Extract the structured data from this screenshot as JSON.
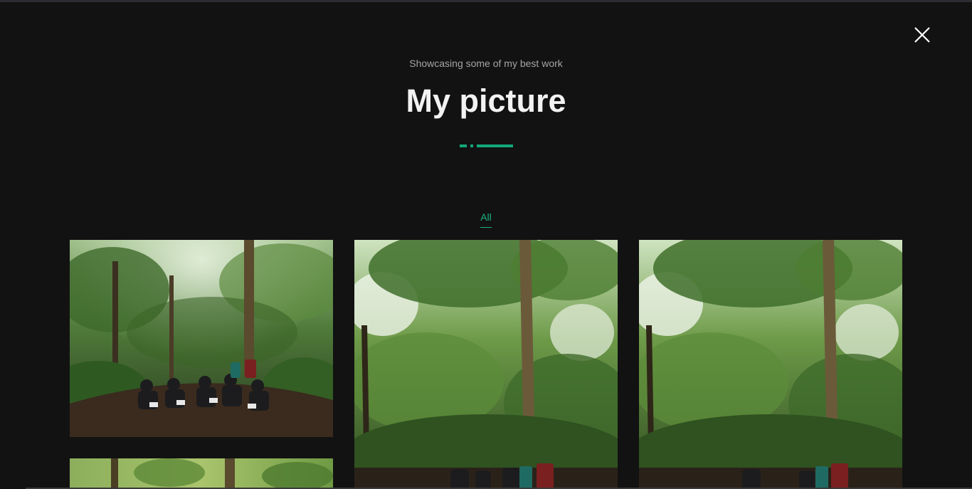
{
  "header": {
    "subtitle": "Showcasing some of my best work",
    "title": "My picture",
    "accent_color": "#12a87a"
  },
  "close_icon": "close-icon",
  "filters": [
    {
      "label": "All",
      "active": true
    }
  ],
  "gallery": [
    {
      "scene": "rainforest with group of hikers seated on trail"
    },
    {
      "scene": "rainforest canopy with tall tree and backpacks"
    },
    {
      "scene": "rainforest canopy with tall tree and backpacks"
    },
    {
      "scene": "rainforest trees"
    }
  ]
}
